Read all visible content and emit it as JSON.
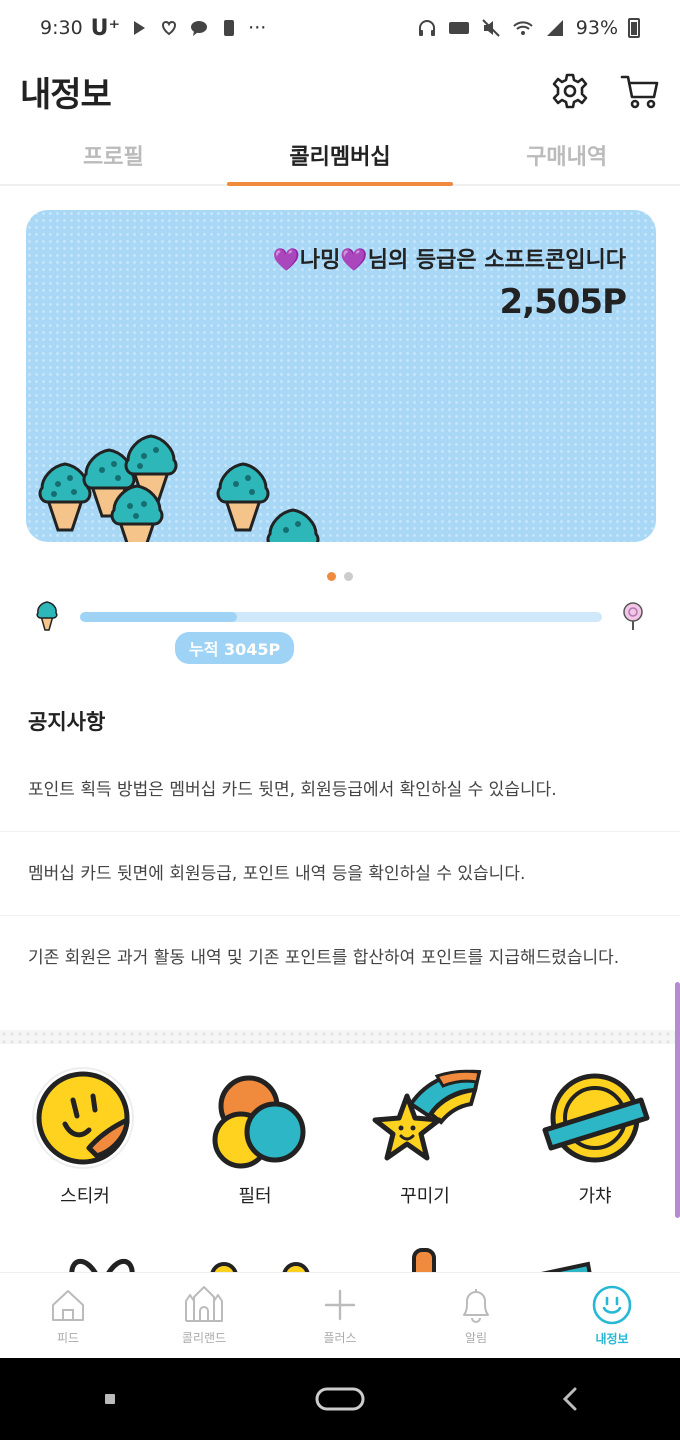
{
  "status_bar": {
    "time": "9:30",
    "carrier": "U⁺",
    "battery": "93%"
  },
  "header": {
    "title": "내정보",
    "settings_icon": "gear-icon",
    "cart_icon": "cart-icon"
  },
  "tabs": [
    {
      "label": "프로필",
      "active": false
    },
    {
      "label": "콜리멤버십",
      "active": true
    },
    {
      "label": "구매내역",
      "active": false
    }
  ],
  "membership_card": {
    "heart_left": "💜",
    "nickname": "나밍",
    "heart_right": "💜",
    "grade_suffix": "님의 등급은 소프트콘입니다",
    "points": "2,505P",
    "background_color": "#a9d8f7"
  },
  "pager": {
    "count": 2,
    "active_index": 0
  },
  "progress": {
    "badge": "누적 3045P",
    "fill_fraction": 0.3
  },
  "notices": {
    "title": "공지사항",
    "items": [
      "포인트 획득 방법은 멤버십 카드 뒷면, 회원등급에서 확인하실 수 있습니다.",
      "멤버십 카드 뒷면에 회원등급, 포인트 내역 등을 확인하실 수 있습니다.",
      "기존 회원은 과거 활동 내역 및 기존 포인트를 합산하여 포인트를 지급해드렸습니다."
    ]
  },
  "shortcuts": [
    {
      "label": "스티커",
      "icon": "smiley-sticker-icon"
    },
    {
      "label": "필터",
      "icon": "color-filter-icon"
    },
    {
      "label": "꾸미기",
      "icon": "shooting-star-icon"
    },
    {
      "label": "가챠",
      "icon": "gacha-capsule-icon"
    }
  ],
  "bottom_nav": [
    {
      "label": "피드",
      "icon": "home-icon",
      "active": false
    },
    {
      "label": "콜리랜드",
      "icon": "castle-icon",
      "active": false
    },
    {
      "label": "플러스",
      "icon": "plus-icon",
      "active": false
    },
    {
      "label": "알림",
      "icon": "bell-icon",
      "active": false
    },
    {
      "label": "내정보",
      "icon": "smile-profile-icon",
      "active": true
    }
  ],
  "colors": {
    "accent_orange": "#f08a3c",
    "accent_blue": "#9fd3f5",
    "active_nav": "#26b8d4",
    "heart_purple": "#7a2bbd"
  }
}
